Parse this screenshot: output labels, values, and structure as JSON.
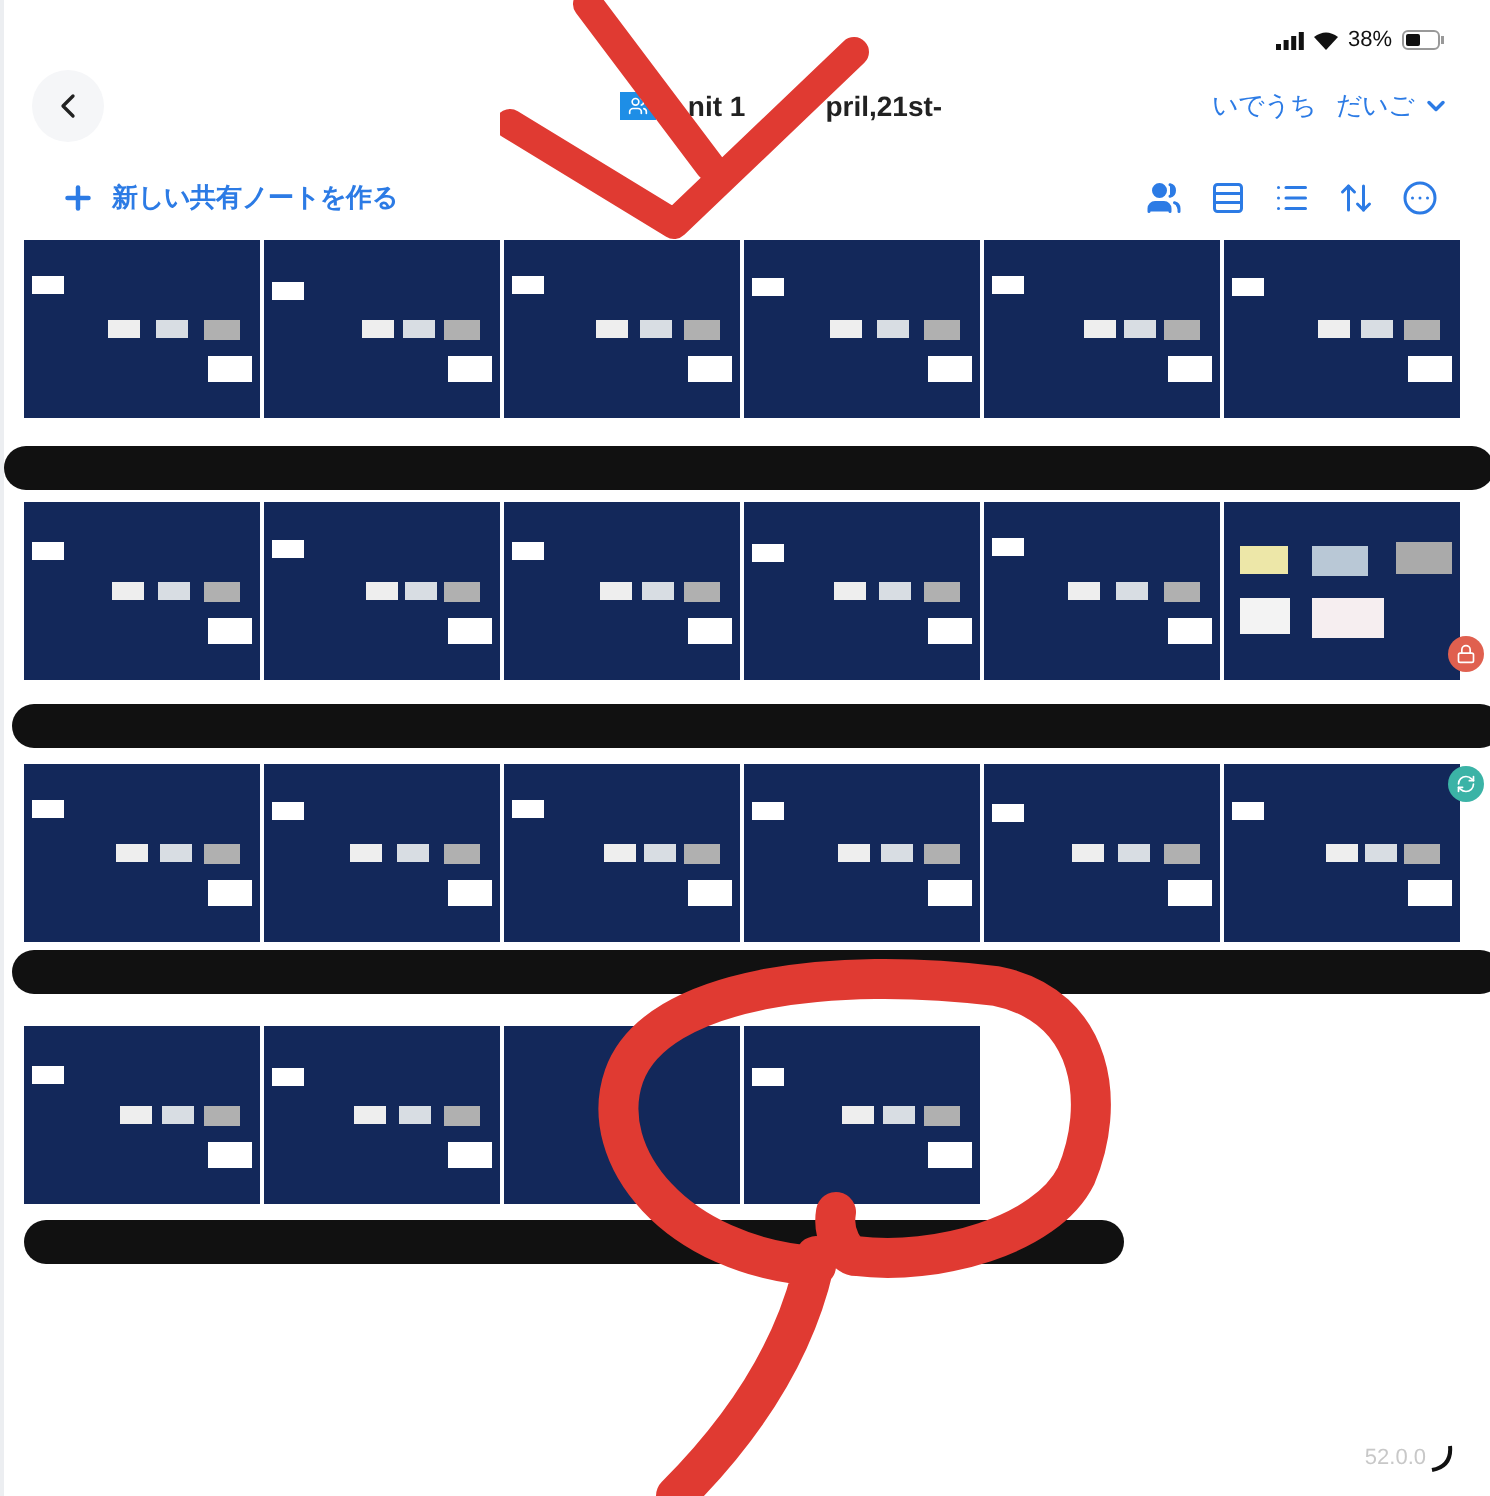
{
  "status_bar": {
    "battery": "38%"
  },
  "header": {
    "title_parts": [
      "nit 1",
      "pril,21st-"
    ],
    "user_menu": [
      "いでうち",
      "だいご"
    ]
  },
  "actions": {
    "new_note": "新しい共有ノートを作る"
  },
  "note_rows": [
    {
      "notes": [
        {
          "kind": "board",
          "locked": false,
          "syncing": false
        },
        {
          "kind": "board",
          "locked": false,
          "syncing": false
        },
        {
          "kind": "board",
          "locked": false,
          "syncing": false
        },
        {
          "kind": "board",
          "locked": false,
          "syncing": false
        },
        {
          "kind": "board",
          "locked": false,
          "syncing": false
        },
        {
          "kind": "board",
          "locked": false,
          "syncing": false
        }
      ]
    },
    {
      "notes": [
        {
          "kind": "board",
          "locked": false,
          "syncing": false
        },
        {
          "kind": "board",
          "locked": false,
          "syncing": false
        },
        {
          "kind": "board",
          "locked": false,
          "syncing": false
        },
        {
          "kind": "board",
          "locked": false,
          "syncing": false
        },
        {
          "kind": "board",
          "locked": false,
          "syncing": false
        },
        {
          "kind": "photo",
          "locked": true,
          "syncing": false
        }
      ]
    },
    {
      "notes": [
        {
          "kind": "board",
          "locked": false,
          "syncing": false
        },
        {
          "kind": "board",
          "locked": false,
          "syncing": false
        },
        {
          "kind": "board",
          "locked": false,
          "syncing": false
        },
        {
          "kind": "board",
          "locked": false,
          "syncing": false
        },
        {
          "kind": "board",
          "locked": false,
          "syncing": false
        },
        {
          "kind": "board",
          "locked": false,
          "syncing": true
        }
      ]
    },
    {
      "notes": [
        {
          "kind": "board",
          "locked": false,
          "syncing": false
        },
        {
          "kind": "board",
          "locked": false,
          "syncing": false
        },
        {
          "kind": "empty",
          "locked": false,
          "syncing": false
        },
        {
          "kind": "board",
          "locked": false,
          "syncing": false
        }
      ]
    }
  ],
  "version": "52.0.0"
}
